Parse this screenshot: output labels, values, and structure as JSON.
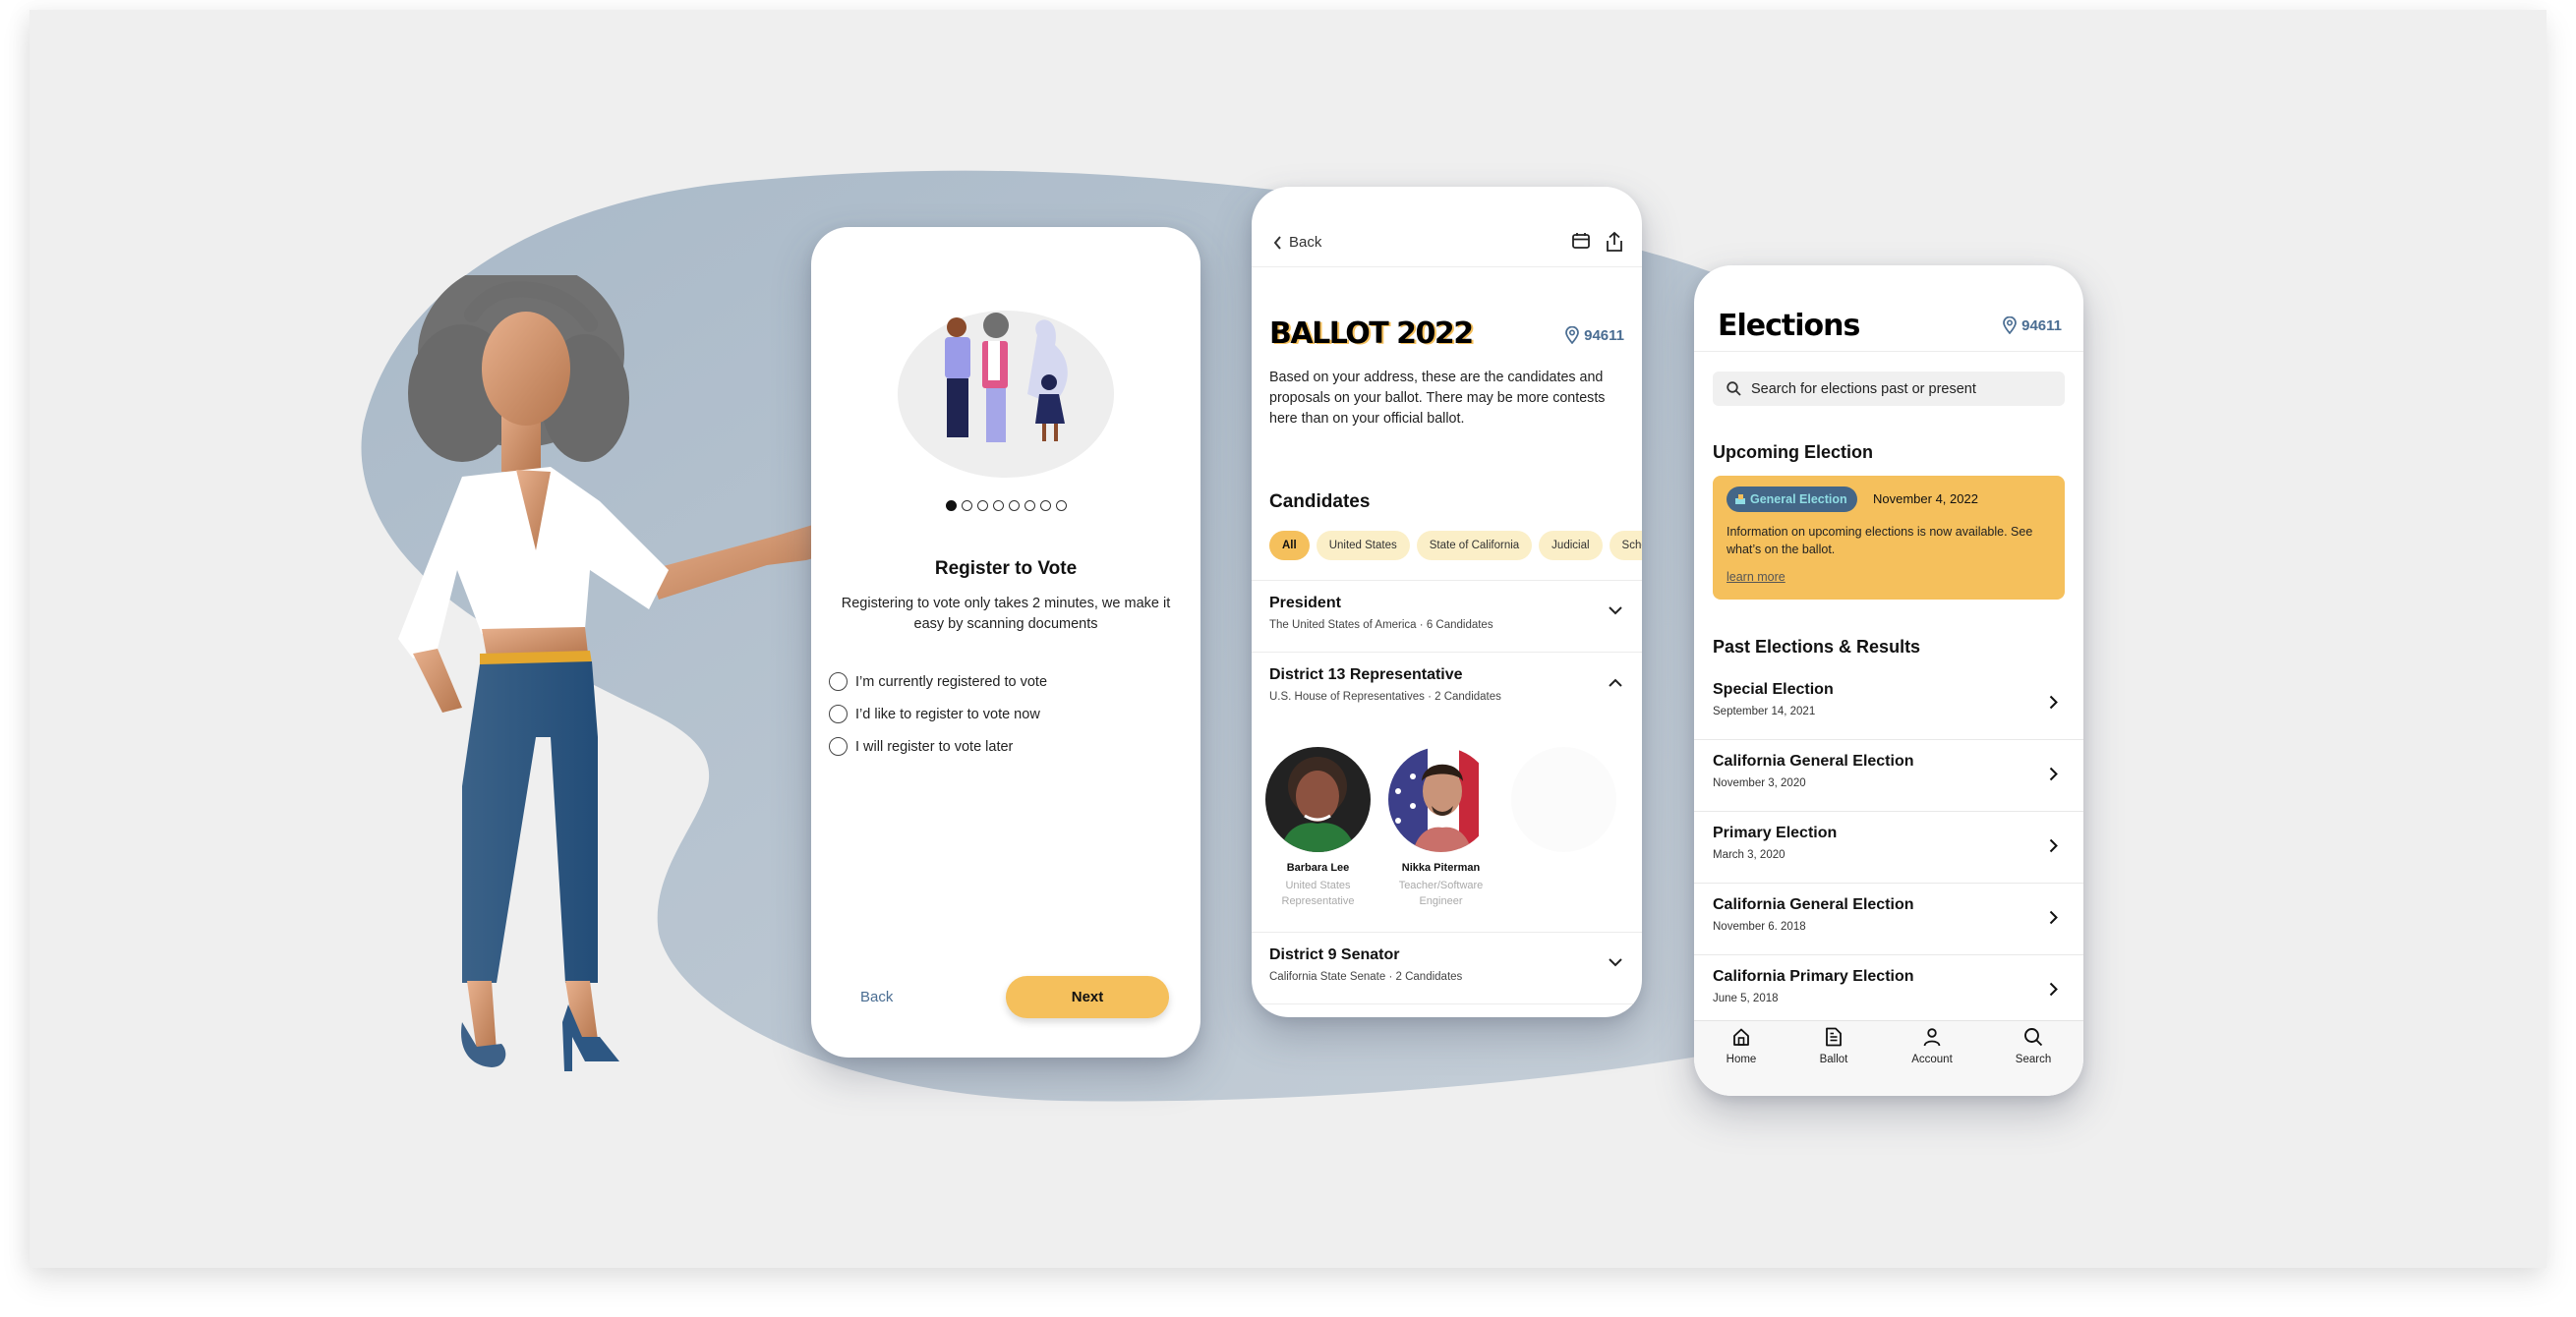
{
  "register": {
    "title": "Register to Vote",
    "subtitle": "Registering to vote only takes 2 minutes, we make it easy by scanning documents",
    "carousel": {
      "total": 8,
      "active_index": 0
    },
    "options": [
      {
        "label": "I’m currently registered to vote",
        "selected": false
      },
      {
        "label": "I’d like to register to vote now",
        "selected": false
      },
      {
        "label": "I will register to vote later",
        "selected": false
      }
    ],
    "back_label": "Back",
    "next_label": "Next"
  },
  "ballot": {
    "back_label": "Back",
    "title": "BALLOT 2022",
    "zip": "94611",
    "description": "Based on your address, these are the candidates and proposals on your ballot. There may be more contests here than on your official ballot.",
    "candidates_heading": "Candidates",
    "filters": [
      {
        "label": "All",
        "active": true
      },
      {
        "label": "United States",
        "active": false
      },
      {
        "label": "State of California",
        "active": false
      },
      {
        "label": "Judicial",
        "active": false
      },
      {
        "label": "School",
        "active": false
      }
    ],
    "contests": [
      {
        "title": "President",
        "jurisdiction": "The United States of America",
        "count": "6 Candidates",
        "expanded": false
      },
      {
        "title": "District 13 Representative",
        "jurisdiction": "U.S. House of Representatives",
        "count": "2 Candidates",
        "expanded": true
      },
      {
        "title": "District 9 Senator",
        "jurisdiction": "California State Senate",
        "count": "2 Candidates",
        "expanded": false
      }
    ],
    "candidates": [
      {
        "name": "Barbara Lee",
        "role": "United States Representative"
      },
      {
        "name": "Nikka Piterman",
        "role": "Teacher/Software Engineer"
      }
    ]
  },
  "elections": {
    "title": "Elections",
    "zip": "94611",
    "search_placeholder": "Search for elections past or present",
    "upcoming_heading": "Upcoming Election",
    "upcoming": {
      "badge": "General Election",
      "date": "November 4, 2022",
      "text": "Information on upcoming elections is now available. See what’s on the ballot.",
      "link": "learn more"
    },
    "past_heading": "Past Elections & Results",
    "past": [
      {
        "title": "Special Election",
        "date": "September 14, 2021"
      },
      {
        "title": "California General Election",
        "date": "November 3, 2020"
      },
      {
        "title": "Primary Election",
        "date": "March 3, 2020"
      },
      {
        "title": "California General Election",
        "date": "November 6. 2018"
      },
      {
        "title": "California Primary Election",
        "date": "June 5, 2018"
      }
    ],
    "tabs": [
      {
        "label": "Home",
        "icon": "home-icon"
      },
      {
        "label": "Ballot",
        "icon": "document-icon"
      },
      {
        "label": "Account",
        "icon": "person-icon"
      },
      {
        "label": "Search",
        "icon": "search-icon"
      }
    ]
  },
  "colors": {
    "accent_yellow": "#f5c05c",
    "chip_light": "#fbefc8",
    "link_blue": "#4a6d92",
    "badge_blue": "#446687",
    "blob": "#b0bfcc",
    "canvas": "#efefef"
  }
}
